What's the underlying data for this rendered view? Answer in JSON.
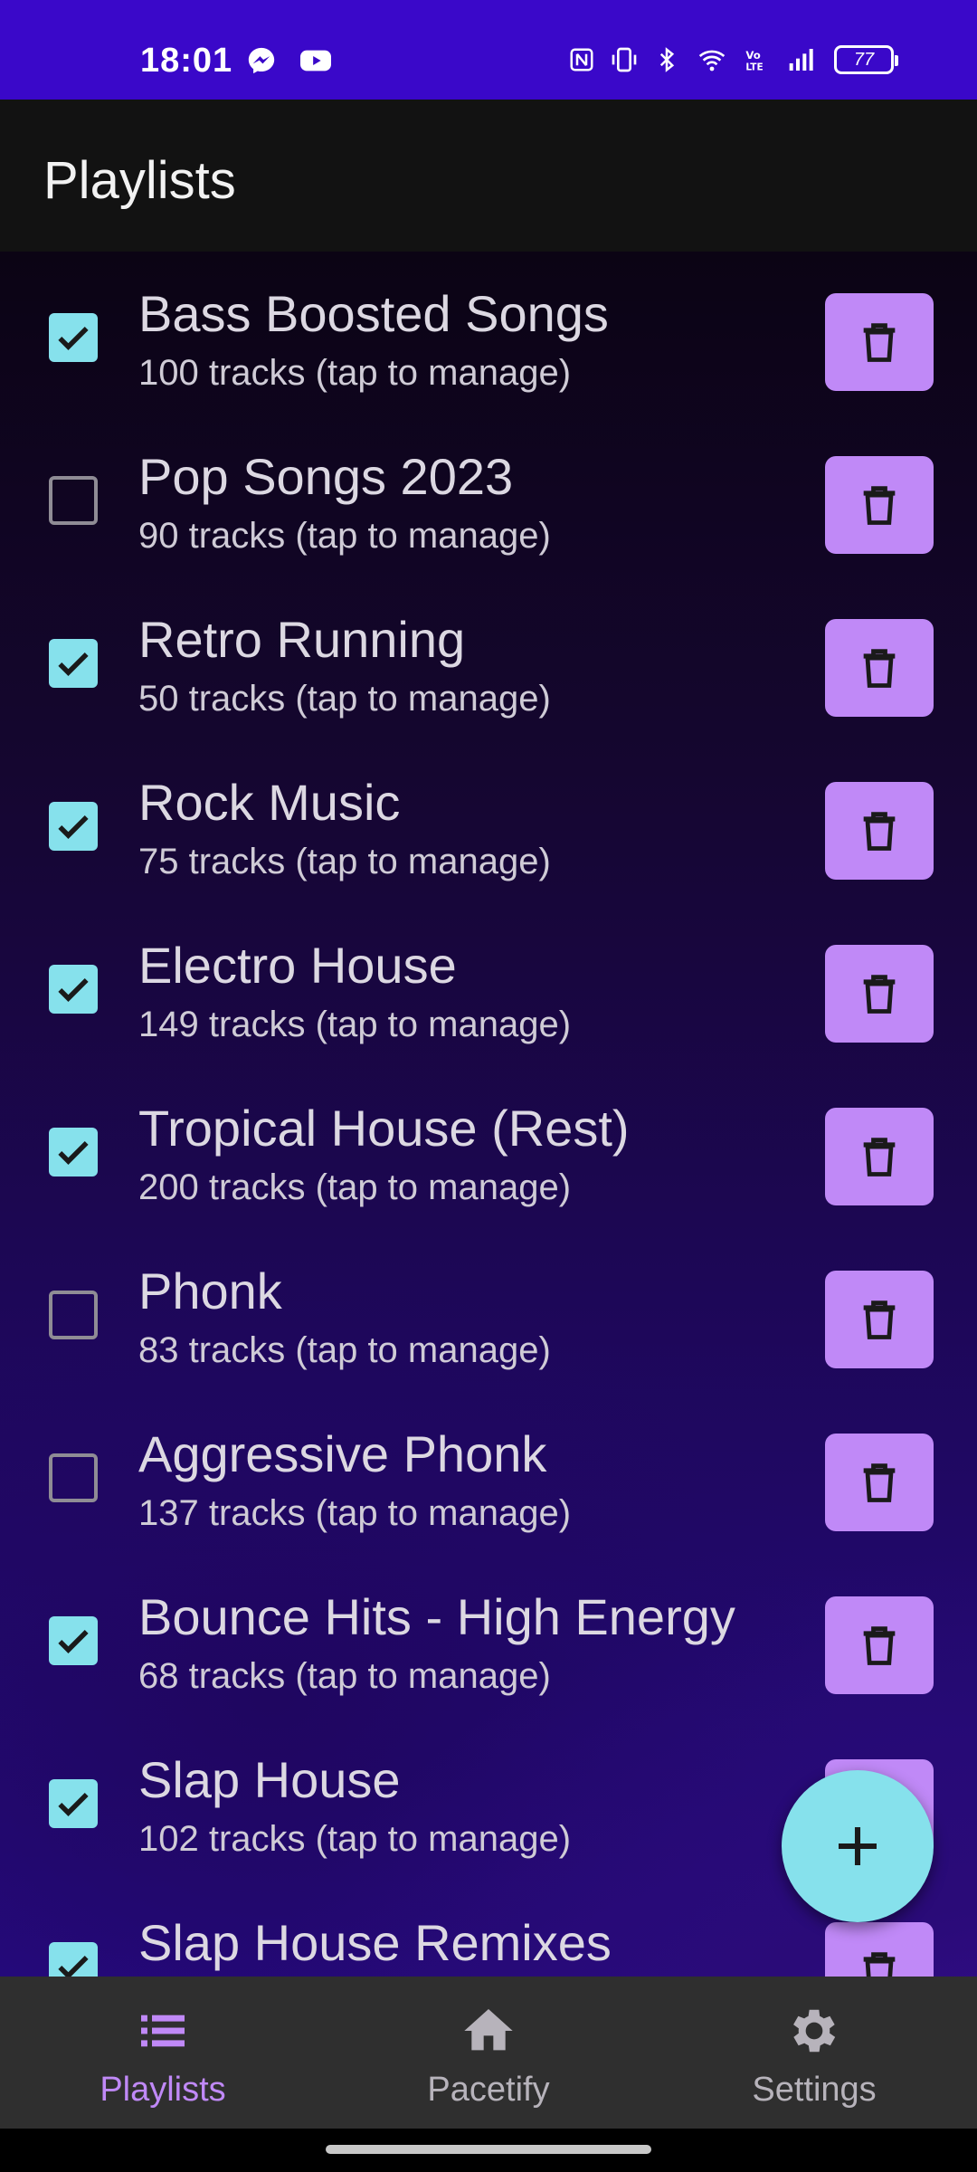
{
  "status_bar": {
    "time": "18:01",
    "left_icons": [
      "messenger-icon",
      "youtube-icon"
    ],
    "right_icons": [
      "nfc-icon",
      "vibrate-icon",
      "bluetooth-icon",
      "wifi-icon",
      "volte-icon",
      "signal-icon"
    ],
    "battery": "77"
  },
  "app_bar": {
    "title": "Playlists"
  },
  "playlists": [
    {
      "name": "Bass Boosted Songs",
      "subtitle": "100 tracks (tap to manage)",
      "checked": true
    },
    {
      "name": "Pop Songs 2023",
      "subtitle": "90 tracks (tap to manage)",
      "checked": false
    },
    {
      "name": "Retro Running",
      "subtitle": "50 tracks (tap to manage)",
      "checked": true
    },
    {
      "name": "Rock Music",
      "subtitle": "75 tracks (tap to manage)",
      "checked": true
    },
    {
      "name": "Electro House",
      "subtitle": "149 tracks (tap to manage)",
      "checked": true
    },
    {
      "name": "Tropical House (Rest)",
      "subtitle": "200 tracks (tap to manage)",
      "checked": true
    },
    {
      "name": "Phonk",
      "subtitle": "83 tracks (tap to manage)",
      "checked": false
    },
    {
      "name": "Aggressive Phonk",
      "subtitle": "137 tracks (tap to manage)",
      "checked": false
    },
    {
      "name": "Bounce Hits - High Energy",
      "subtitle": "68 tracks (tap to manage)",
      "checked": true
    },
    {
      "name": "Slap House",
      "subtitle": "102 tracks (tap to manage)",
      "checked": true
    },
    {
      "name": "Slap House Remixes",
      "subtitle": "",
      "checked": true
    }
  ],
  "fab": {
    "icon": "plus-icon"
  },
  "bottom_nav": {
    "items": [
      {
        "label": "Playlists",
        "icon": "list-icon",
        "active": true
      },
      {
        "label": "Pacetify",
        "icon": "home-icon",
        "active": false
      },
      {
        "label": "Settings",
        "icon": "gear-icon",
        "active": false
      }
    ]
  },
  "colors": {
    "status_bar": "#3a08c9",
    "app_bar": "#121212",
    "accent_cyan": "#86e1ec",
    "accent_purple": "#c089f7",
    "nav_bg": "#2f2f2f"
  }
}
